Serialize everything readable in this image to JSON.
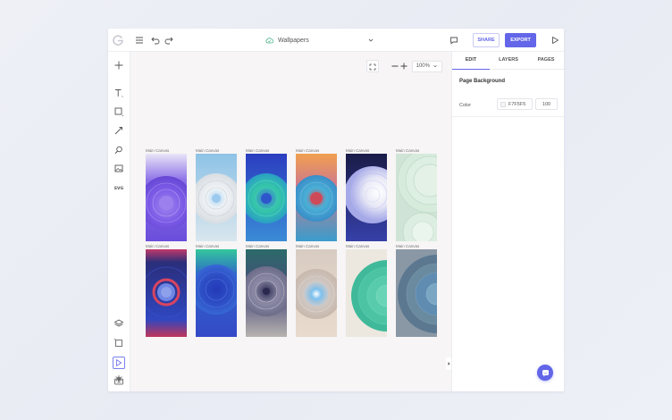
{
  "app": {
    "document_title": "Wallpapers"
  },
  "topbar": {
    "share_label": "SHARE",
    "export_label": "EXPORT"
  },
  "zoom": {
    "value": "100%"
  },
  "canvas": {
    "background": "#F7F5F5",
    "thumbnails": [
      {
        "label": "Main Canvas",
        "style": "purple"
      },
      {
        "label": "Main Canvas",
        "style": "silver-blue"
      },
      {
        "label": "Main Canvas",
        "style": "teal-blue"
      },
      {
        "label": "Main Canvas",
        "style": "orange-red"
      },
      {
        "label": "Main Canvas",
        "style": "navy-white"
      },
      {
        "label": "Main Canvas",
        "style": "mint-rings"
      },
      {
        "label": "Main Canvas",
        "style": "red-ring-navy"
      },
      {
        "label": "Main Canvas",
        "style": "mint-cobalt"
      },
      {
        "label": "Main Canvas",
        "style": "dark-gray"
      },
      {
        "label": "Main Canvas",
        "style": "beige-blue"
      },
      {
        "label": "Main Canvas",
        "style": "mint-half"
      },
      {
        "label": "Main Canvas",
        "style": "slate-half"
      }
    ]
  },
  "panel": {
    "tabs": [
      {
        "label": "EDIT",
        "active": true
      },
      {
        "label": "LAYERS",
        "active": false
      },
      {
        "label": "PAGES",
        "active": false
      }
    ],
    "section_title": "Page Background",
    "color_label": "Color",
    "color_hex": "F7F5F5",
    "opacity": "100"
  },
  "colors": {
    "accent": "#6366E8",
    "canvas_bg": "#F7F5F5"
  }
}
